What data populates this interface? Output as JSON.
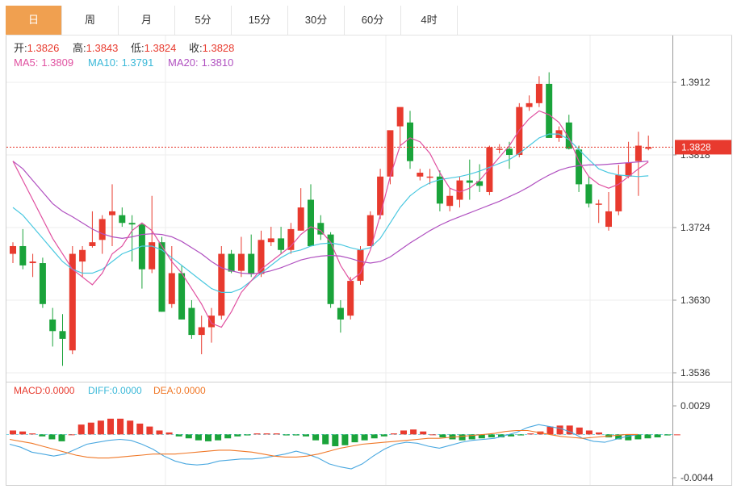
{
  "tabs": [
    "日",
    "周",
    "月",
    "5分",
    "15分",
    "30分",
    "60分",
    "4时"
  ],
  "active_tab": 0,
  "colors": {
    "up": "#e83a2e",
    "down": "#1aa33a",
    "ma5": "#e050a0",
    "ma10": "#4ac8e0",
    "ma20": "#b050c0",
    "dea": "#f07828",
    "accent": "#f0a050"
  },
  "info": {
    "open_label": "开:",
    "open": "1.3826",
    "high_label": "高:",
    "high": "1.3843",
    "low_label": "低:",
    "low": "1.3824",
    "close_label": "收:",
    "close": "1.3828"
  },
  "ma_legend": {
    "ma5_label": "MA5:",
    "ma5": "1.3809",
    "ma10_label": "MA10:",
    "ma10": "1.3791",
    "ma20_label": "MA20:",
    "ma20": "1.3810"
  },
  "macd_legend": {
    "macd_label": "MACD:",
    "macd": "0.0000",
    "diff_label": "DIFF:",
    "diff": "0.0000",
    "dea_label": "DEA:",
    "dea": "0.0000"
  },
  "price_axis": {
    "ticks": [
      "1.3912",
      "1.3818",
      "1.3724",
      "1.3630",
      "1.3536"
    ],
    "current": "1.3828"
  },
  "macd_axis": {
    "ticks": [
      "0.0029",
      "-0.0044"
    ]
  },
  "chart_data": {
    "type": "candlestick",
    "ylim": [
      1.3536,
      1.3912
    ],
    "candles": [
      [
        1.369,
        1.3705,
        1.3678,
        1.37
      ],
      [
        1.37,
        1.3722,
        1.367,
        1.3675
      ],
      [
        1.3678,
        1.369,
        1.366,
        1.368
      ],
      [
        1.3678,
        1.3685,
        1.362,
        1.3625
      ],
      [
        1.3605,
        1.362,
        1.357,
        1.359
      ],
      [
        1.359,
        1.3612,
        1.3545,
        1.358
      ],
      [
        1.3565,
        1.37,
        1.356,
        1.369
      ],
      [
        1.368,
        1.37,
        1.366,
        1.3695
      ],
      [
        1.37,
        1.3745,
        1.3698,
        1.3705
      ],
      [
        1.3708,
        1.374,
        1.369,
        1.3735
      ],
      [
        1.374,
        1.378,
        1.37,
        1.3745
      ],
      [
        1.374,
        1.375,
        1.3725,
        1.373
      ],
      [
        1.373,
        1.374,
        1.368,
        1.3728
      ],
      [
        1.3728,
        1.373,
        1.3645,
        1.367
      ],
      [
        1.367,
        1.3765,
        1.3665,
        1.3705
      ],
      [
        1.3705,
        1.3712,
        1.3615,
        1.3615
      ],
      [
        1.3625,
        1.37,
        1.362,
        1.3665
      ],
      [
        1.3665,
        1.3675,
        1.3605,
        1.3605
      ],
      [
        1.362,
        1.363,
        1.358,
        1.3585
      ],
      [
        1.3585,
        1.361,
        1.356,
        1.3595
      ],
      [
        1.3595,
        1.362,
        1.3575,
        1.361
      ],
      [
        1.361,
        1.37,
        1.3605,
        1.369
      ],
      [
        1.369,
        1.3695,
        1.3665,
        1.3667
      ],
      [
        1.3668,
        1.3712,
        1.366,
        1.369
      ],
      [
        1.369,
        1.3715,
        1.366,
        1.3664
      ],
      [
        1.3664,
        1.372,
        1.366,
        1.3708
      ],
      [
        1.3705,
        1.3725,
        1.37,
        1.371
      ],
      [
        1.371,
        1.3725,
        1.369,
        1.3695
      ],
      [
        1.3695,
        1.373,
        1.369,
        1.3722
      ],
      [
        1.372,
        1.3775,
        1.372,
        1.375
      ],
      [
        1.376,
        1.378,
        1.37,
        1.37
      ],
      [
        1.373,
        1.374,
        1.3708,
        1.3715
      ],
      [
        1.3715,
        1.3718,
        1.362,
        1.3625
      ],
      [
        1.362,
        1.363,
        1.3588,
        1.3605
      ],
      [
        1.361,
        1.366,
        1.3605,
        1.3655
      ],
      [
        1.3655,
        1.37,
        1.365,
        1.3695
      ],
      [
        1.37,
        1.3745,
        1.37,
        1.374
      ],
      [
        1.374,
        1.38,
        1.3735,
        1.379
      ],
      [
        1.379,
        1.3845,
        1.378,
        1.385
      ],
      [
        1.3855,
        1.387,
        1.383,
        1.388
      ],
      [
        1.386,
        1.3875,
        1.38,
        1.381
      ],
      [
        1.379,
        1.38,
        1.3785,
        1.3795
      ],
      [
        1.379,
        1.38,
        1.378,
        1.379
      ],
      [
        1.379,
        1.3798,
        1.3745,
        1.3755
      ],
      [
        1.3752,
        1.3775,
        1.3745,
        1.3765
      ],
      [
        1.376,
        1.379,
        1.375,
        1.3785
      ],
      [
        1.3785,
        1.3812,
        1.376,
        1.3782
      ],
      [
        1.3784,
        1.3806,
        1.377,
        1.3778
      ],
      [
        1.377,
        1.383,
        1.3766,
        1.3828
      ],
      [
        1.3826,
        1.3832,
        1.382,
        1.3826
      ],
      [
        1.3826,
        1.3835,
        1.38,
        1.3818
      ],
      [
        1.3818,
        1.3885,
        1.3815,
        1.388
      ],
      [
        1.388,
        1.3895,
        1.3875,
        1.3885
      ],
      [
        1.3885,
        1.392,
        1.388,
        1.391
      ],
      [
        1.391,
        1.3925,
        1.384,
        1.384
      ],
      [
        1.384,
        1.3855,
        1.3835,
        1.385
      ],
      [
        1.386,
        1.387,
        1.3825,
        1.3826
      ],
      [
        1.3825,
        1.383,
        1.377,
        1.378
      ],
      [
        1.378,
        1.379,
        1.375,
        1.3755
      ],
      [
        1.3755,
        1.376,
        1.373,
        1.3755
      ],
      [
        1.3725,
        1.377,
        1.372,
        1.3745
      ],
      [
        1.3745,
        1.3805,
        1.374,
        1.3792
      ],
      [
        1.379,
        1.3835,
        1.3788,
        1.3808
      ],
      [
        1.381,
        1.3848,
        1.3765,
        1.383
      ],
      [
        1.3826,
        1.3843,
        1.3824,
        1.3828
      ]
    ],
    "ma5": [
      1.381,
      1.3785,
      1.376,
      1.3735,
      1.371,
      1.369,
      1.367,
      1.366,
      1.365,
      1.3665,
      1.369,
      1.37,
      1.372,
      1.373,
      1.372,
      1.37,
      1.368,
      1.3665,
      1.3645,
      1.3625,
      1.36,
      1.3595,
      1.3615,
      1.364,
      1.3655,
      1.367,
      1.368,
      1.369,
      1.37,
      1.3715,
      1.3725,
      1.372,
      1.3705,
      1.3675,
      1.3655,
      1.3665,
      1.3695,
      1.374,
      1.379,
      1.383,
      1.384,
      1.3835,
      1.382,
      1.3795,
      1.3775,
      1.377,
      1.3775,
      1.3785,
      1.38,
      1.3815,
      1.383,
      1.385,
      1.3865,
      1.3875,
      1.387,
      1.386,
      1.384,
      1.381,
      1.379,
      1.378,
      1.3775,
      1.378,
      1.379,
      1.38,
      1.3809
    ],
    "ma10": [
      1.375,
      1.374,
      1.3725,
      1.371,
      1.3695,
      1.368,
      1.367,
      1.3665,
      1.3665,
      1.367,
      1.368,
      1.369,
      1.3695,
      1.37,
      1.37,
      1.3695,
      1.3685,
      1.3675,
      1.3665,
      1.3655,
      1.3645,
      1.364,
      1.364,
      1.3645,
      1.3655,
      1.3665,
      1.3675,
      1.3685,
      1.3692,
      1.3695,
      1.37,
      1.3703,
      1.3704,
      1.3702,
      1.3698,
      1.3695,
      1.3698,
      1.371,
      1.373,
      1.375,
      1.3765,
      1.3775,
      1.3782,
      1.3786,
      1.3788,
      1.379,
      1.3793,
      1.3797,
      1.3802,
      1.3807,
      1.3812,
      1.382,
      1.383,
      1.384,
      1.3845,
      1.3845,
      1.3838,
      1.3825,
      1.3812,
      1.38,
      1.3795,
      1.3792,
      1.3791,
      1.379,
      1.3791
    ],
    "ma20": [
      1.381,
      1.38,
      1.3785,
      1.377,
      1.3755,
      1.3745,
      1.3738,
      1.373,
      1.3722,
      1.3716,
      1.3712,
      1.371,
      1.3712,
      1.3715,
      1.3716,
      1.3715,
      1.3712,
      1.3706,
      1.3698,
      1.369,
      1.368,
      1.3672,
      1.3668,
      1.3665,
      1.3664,
      1.3665,
      1.3668,
      1.3672,
      1.3677,
      1.3682,
      1.3685,
      1.3687,
      1.3688,
      1.3687,
      1.3684,
      1.368,
      1.3678,
      1.368,
      1.3686,
      1.3695,
      1.3704,
      1.3712,
      1.372,
      1.3727,
      1.3733,
      1.3738,
      1.3743,
      1.3748,
      1.3753,
      1.3758,
      1.3764,
      1.377,
      1.3777,
      1.3785,
      1.3792,
      1.3798,
      1.3802,
      1.3804,
      1.3805,
      1.3805,
      1.3806,
      1.3807,
      1.3808,
      1.3809,
      1.381
    ],
    "macd_ylim": [
      -0.0044,
      0.0029
    ],
    "macd_hist": [
      0.0004,
      0.0003,
      0.0001,
      -0.0002,
      -0.0005,
      -0.0007,
      0.0,
      0.001,
      0.0012,
      0.0014,
      0.0016,
      0.0016,
      0.0014,
      0.0011,
      0.0008,
      0.0004,
      0.0002,
      -0.0002,
      -0.0004,
      -0.0006,
      -0.0007,
      -0.0006,
      -0.0004,
      -0.0002,
      -0.0001,
      0.0001,
      0.0001,
      0.0001,
      -0.0001,
      -0.0001,
      -0.0002,
      -0.0006,
      -0.001,
      -0.0012,
      -0.0011,
      -0.0008,
      -0.0006,
      -0.0004,
      -0.0002,
      0.0001,
      0.0004,
      0.0005,
      0.0003,
      0.0,
      -0.0003,
      -0.0005,
      -0.0006,
      -0.0005,
      -0.0004,
      -0.0003,
      -0.0003,
      -0.0002,
      -0.0001,
      0.0001,
      0.0003,
      0.0008,
      0.0009,
      0.0009,
      0.0007,
      0.0004,
      0.0002,
      -0.0003,
      -0.0005,
      -0.0006,
      -0.0005,
      -0.0004,
      -0.0003,
      -0.0001,
      0.0
    ],
    "diff": [
      -0.001,
      -0.0013,
      -0.0018,
      -0.002,
      -0.0022,
      -0.002,
      -0.0015,
      -0.001,
      -0.0008,
      -0.0006,
      -0.0005,
      -0.0006,
      -0.001,
      -0.0015,
      -0.0022,
      -0.0027,
      -0.003,
      -0.0031,
      -0.003,
      -0.0027,
      -0.0026,
      -0.0025,
      -0.0025,
      -0.0024,
      -0.0022,
      -0.002,
      -0.0017,
      -0.002,
      -0.0024,
      -0.003,
      -0.0033,
      -0.0035,
      -0.003,
      -0.0022,
      -0.0015,
      -0.001,
      -0.0008,
      -0.0009,
      -0.0012,
      -0.0014,
      -0.0011,
      -0.0008,
      -0.0006,
      -0.0005,
      -0.0004,
      -0.0001,
      0.0002,
      0.0007,
      0.001,
      0.0008,
      0.0006,
      0.0002,
      -0.0004,
      -0.0007,
      -0.0008,
      -0.0005,
      -0.0002,
      0.0
    ],
    "dea": [
      -0.0005,
      -0.0007,
      -0.0009,
      -0.0012,
      -0.0015,
      -0.0018,
      -0.0021,
      -0.0023,
      -0.0024,
      -0.0024,
      -0.0023,
      -0.0022,
      -0.0021,
      -0.002,
      -0.002,
      -0.002,
      -0.0019,
      -0.0018,
      -0.0017,
      -0.0016,
      -0.0016,
      -0.0017,
      -0.0018,
      -0.002,
      -0.0022,
      -0.0023,
      -0.0023,
      -0.0022,
      -0.002,
      -0.0017,
      -0.0014,
      -0.0012,
      -0.001,
      -0.0009,
      -0.0008,
      -0.0007,
      -0.0006,
      -0.0005,
      -0.0004,
      -0.0004,
      -0.0003,
      -0.0002,
      -0.0001,
      0.0,
      0.0001,
      0.0003,
      0.0004,
      0.0004,
      0.0002,
      0.0,
      -0.0002,
      -0.0003,
      -0.0004,
      -0.0003,
      -0.0002,
      -0.0001,
      0.0,
      0.0
    ]
  }
}
